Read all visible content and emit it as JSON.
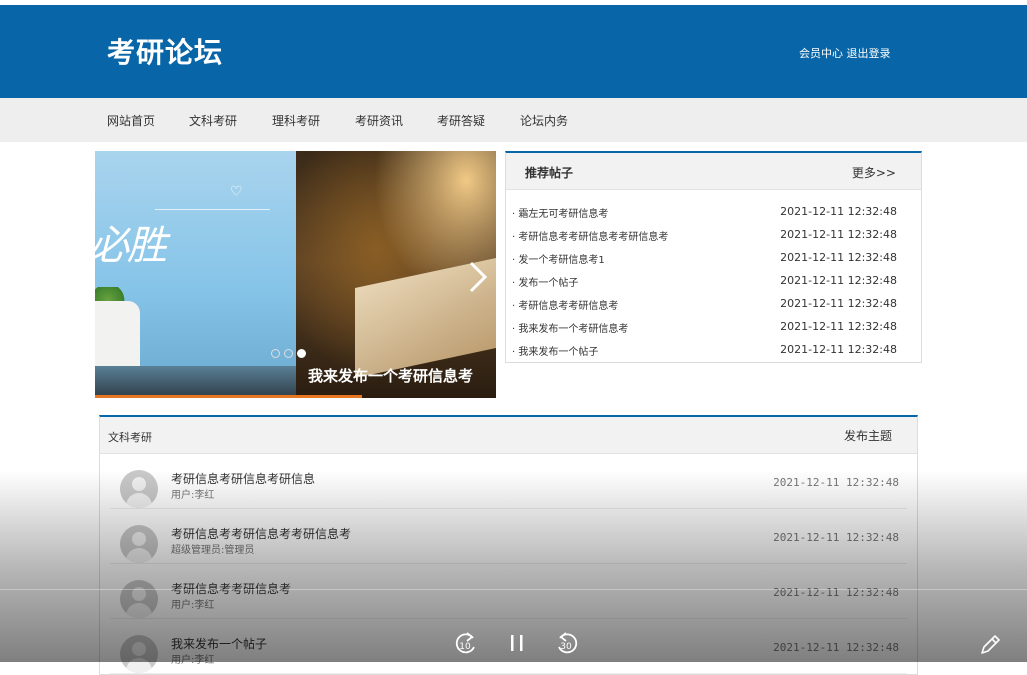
{
  "header": {
    "site_title": "考研论坛",
    "member_center": "会员中心",
    "logout": "退出登录"
  },
  "nav": {
    "items": [
      "网站首页",
      "文科考研",
      "理科考研",
      "考研资讯",
      "考研答疑",
      "论坛内务"
    ]
  },
  "slider": {
    "caption": "我来发布一个考研信息考",
    "left_text": "必胜",
    "next_icon": "chevron-right-icon",
    "dots": 3,
    "active_dot": 3
  },
  "recommended": {
    "title": "推荐帖子",
    "more": "更多>>",
    "items": [
      {
        "title": "· 霜左无可考研信息考",
        "date": "2021-12-11 12:32:48"
      },
      {
        "title": "· 考研信息考考研信息考考研信息考",
        "date": "2021-12-11 12:32:48"
      },
      {
        "title": "· 发一个考研信息考1",
        "date": "2021-12-11 12:32:48"
      },
      {
        "title": "· 发布一个帖子",
        "date": "2021-12-11 12:32:48"
      },
      {
        "title": "· 考研信息考考研信息考",
        "date": "2021-12-11 12:32:48"
      },
      {
        "title": "· 我来发布一个考研信息考",
        "date": "2021-12-11 12:32:48"
      },
      {
        "title": "· 我来发布一个帖子",
        "date": "2021-12-11 12:32:48"
      }
    ]
  },
  "board": {
    "title": "文科考研",
    "post_button": "发布主题",
    "threads": [
      {
        "title": "考研信息考研信息考研信息",
        "author": "用户:李红",
        "date": "2021-12-11 12:32:48"
      },
      {
        "title": "考研信息考考研信息考考研信息考",
        "author": "超级管理员:管理员",
        "date": "2021-12-11 12:32:48"
      },
      {
        "title": "考研信息考考研信息考",
        "author": "用户:李红",
        "date": "2021-12-11 12:32:48"
      },
      {
        "title": "我来发布一个帖子",
        "author": "用户:李红",
        "date": "2021-12-11 12:32:48"
      }
    ]
  },
  "player": {
    "rewind_seconds": "10",
    "forward_seconds": "30",
    "icons": [
      "rewind-10-icon",
      "pause-icon",
      "forward-30-icon",
      "pencil-icon"
    ]
  }
}
